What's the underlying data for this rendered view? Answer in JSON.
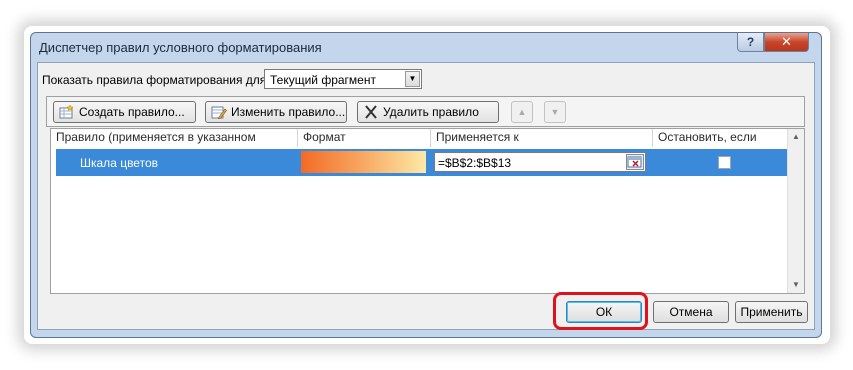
{
  "dialog": {
    "title": "Диспетчер правил условного форматирования",
    "help_icon": "?",
    "close_icon": "✕"
  },
  "show_rules": {
    "label": "Показать правила форматирования для:",
    "selected": "Текущий фрагмент"
  },
  "toolbar": {
    "create": "Создать правило...",
    "edit": "Изменить правило...",
    "delete": "Удалить правило",
    "move_up_icon": "▲",
    "move_down_icon": "▼"
  },
  "columns": {
    "rule": "Правило (применяется в указанном порядке)",
    "format": "Формат",
    "applies_to": "Применяется к",
    "stop_if_true": "Остановить, если истина"
  },
  "rules": [
    {
      "name": "Шкала цветов",
      "applies_to": "=$B$2:$B$13",
      "stop_if_true": false,
      "format_colors": [
        "#f26b26",
        "#f7a35d",
        "#fde9a6"
      ]
    }
  ],
  "buttons": {
    "ok": "ОК",
    "cancel": "Отмена",
    "apply": "Применить"
  },
  "colors": {
    "selection": "#3b8ad9",
    "highlight": "#e0131d",
    "window_frame": "#c3d6ec"
  }
}
